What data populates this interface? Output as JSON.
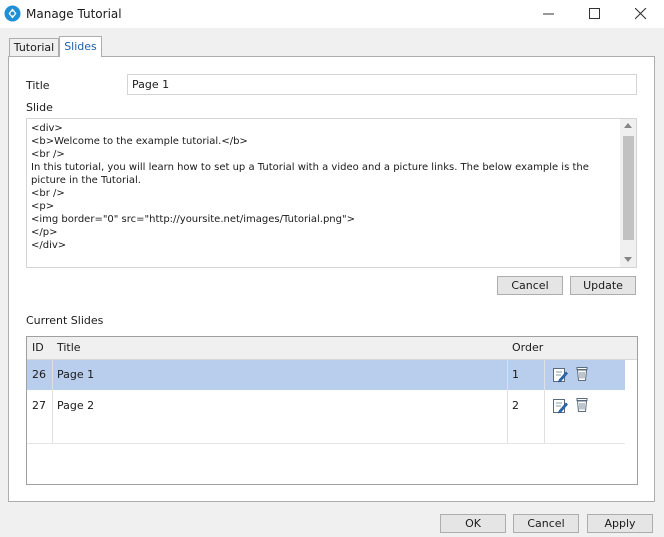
{
  "window": {
    "title": "Manage Tutorial",
    "accent_color": "#1b5fa8"
  },
  "tabs": [
    {
      "label": "Tutorial",
      "selected": false
    },
    {
      "label": "Slides",
      "selected": true
    }
  ],
  "form": {
    "title_label": "Title",
    "title_value": "Page 1",
    "slide_label": "Slide",
    "slide_content": "<div>\n<b>Welcome to the example tutorial.</b>\n<br />\nIn this tutorial, you will learn how to set up a Tutorial with a video and a picture links. The below example is the picture in the Tutorial.\n<br />\n<p>\n<img border=\"0\" src=\"http://yoursite.net/images/Tutorial.png\">\n</p>\n</div>",
    "cancel_label": "Cancel",
    "update_label": "Update"
  },
  "slides": {
    "section_label": "Current Slides",
    "columns": {
      "id": "ID",
      "title": "Title",
      "order": "Order"
    },
    "rows": [
      {
        "id": "26",
        "title": "Page 1",
        "order": "1",
        "selected": true
      },
      {
        "id": "27",
        "title": "Page 2",
        "order": "2",
        "selected": false
      }
    ],
    "row_actions": [
      "edit-icon",
      "delete-icon"
    ],
    "selected_row_color": "#b9cdec"
  },
  "footer": {
    "ok_label": "OK",
    "cancel_label": "Cancel",
    "apply_label": "Apply"
  }
}
